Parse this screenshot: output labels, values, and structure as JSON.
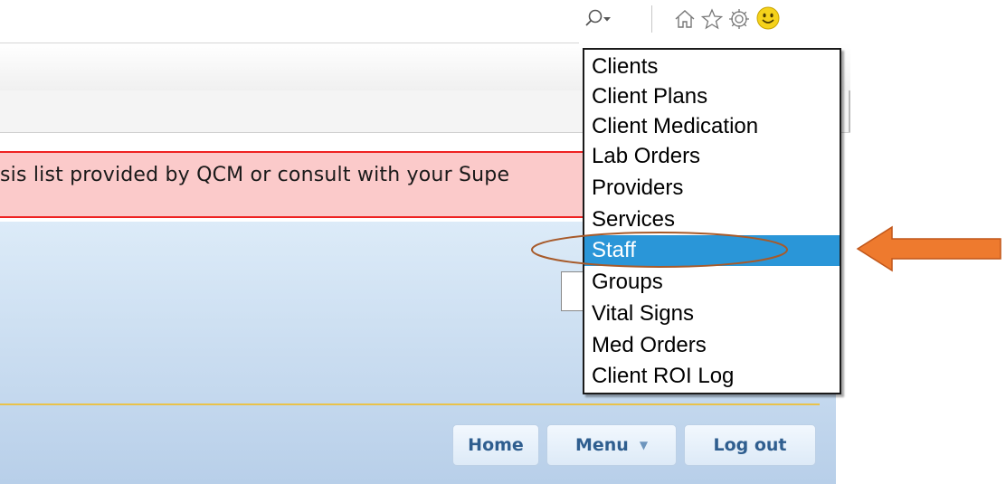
{
  "browser": {
    "icons": [
      "search-icon",
      "chevron-down-icon",
      "home-icon",
      "star-icon",
      "gear-icon",
      "smiley-icon"
    ]
  },
  "alert": {
    "text": "sis list provided by QCM or consult with your Supe"
  },
  "nav_buttons": {
    "home": "Home",
    "menu": "Menu",
    "menu_caret": "▼",
    "logout": "Log out"
  },
  "dropdown": {
    "items": [
      "Clients",
      "Client Plans",
      "Client Medication",
      "Lab Orders",
      "Providers",
      "Services",
      "Staff",
      "Groups",
      "Vital Signs",
      "Med Orders",
      "Client ROI Log"
    ],
    "selected": "Staff"
  },
  "colors": {
    "selected_bg": "#2a96d8",
    "annotation_arrow": "#ee7a2e",
    "annotation_ellipse": "#a75a2a",
    "alert_bg": "#fbcaca",
    "alert_border": "#e22222"
  }
}
